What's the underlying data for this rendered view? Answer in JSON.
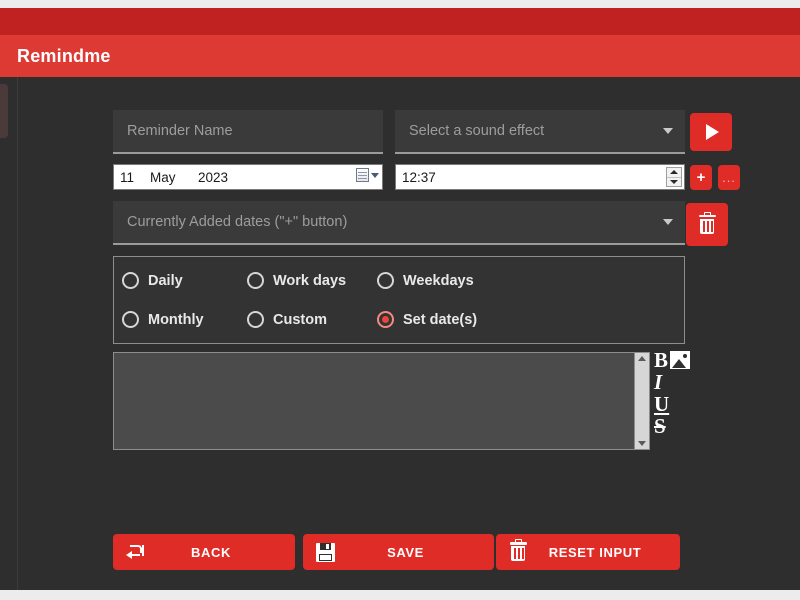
{
  "window": {
    "title": "Remindme"
  },
  "form": {
    "reminder_name": {
      "placeholder": "Reminder Name",
      "value": ""
    },
    "sound_effect": {
      "selected_label": "Select a sound effect",
      "caret_icon": "chevron-down-icon"
    },
    "play_button": {
      "icon": "play-icon",
      "label": ""
    },
    "date": {
      "day": "11",
      "month": "May",
      "year": "2023",
      "calendar_icon": "calendar-icon",
      "caret_icon": "chevron-down-icon"
    },
    "time": {
      "value": "12:37",
      "spinner_up_icon": "chevron-up-icon",
      "spinner_down_icon": "chevron-down-icon"
    },
    "add_date_button": {
      "label": "+",
      "icon": "plus-icon"
    },
    "more_button": {
      "label": "...",
      "icon": "ellipsis-icon"
    },
    "added_dates": {
      "selected_label": "Currently Added dates (\"+\" button)",
      "caret_icon": "chevron-down-icon"
    },
    "delete_dates_button": {
      "icon": "trash-icon",
      "label": ""
    },
    "repeat_options": [
      {
        "id": "daily",
        "label": "Daily",
        "checked": false
      },
      {
        "id": "workdays",
        "label": "Work days",
        "checked": false
      },
      {
        "id": "weekdays",
        "label": "Weekdays",
        "checked": false
      },
      {
        "id": "monthly",
        "label": "Monthly",
        "checked": false
      },
      {
        "id": "custom",
        "label": "Custom",
        "checked": false
      },
      {
        "id": "setdates",
        "label": "Set date(s)",
        "checked": true
      }
    ],
    "notes": {
      "value": "",
      "placeholder": ""
    },
    "format_tools": [
      {
        "id": "bold",
        "glyph": "B",
        "icon": "bold-icon"
      },
      {
        "id": "insert-image",
        "glyph": "",
        "icon": "image-icon"
      },
      {
        "id": "italic",
        "glyph": "I",
        "icon": "italic-icon"
      },
      {
        "id": "underline",
        "glyph": "U",
        "icon": "underline-icon"
      },
      {
        "id": "strikethrough",
        "glyph": "S",
        "icon": "strikethrough-icon"
      }
    ]
  },
  "footer": {
    "back_label": "BACK",
    "back_icon": "back-arrow-icon",
    "save_label": "SAVE",
    "save_icon": "floppy-disk-icon",
    "reset_label": "RESET INPUT",
    "reset_icon": "trash-icon"
  },
  "colors": {
    "accent_red": "#e02c26",
    "titlebar_red": "#dd3a34",
    "accent_bar_red": "#bf2220",
    "app_background": "#2e2e2e",
    "field_background": "#3a3a3a",
    "editor_background": "#4b4b4b",
    "radio_checked": "#e8453c"
  }
}
